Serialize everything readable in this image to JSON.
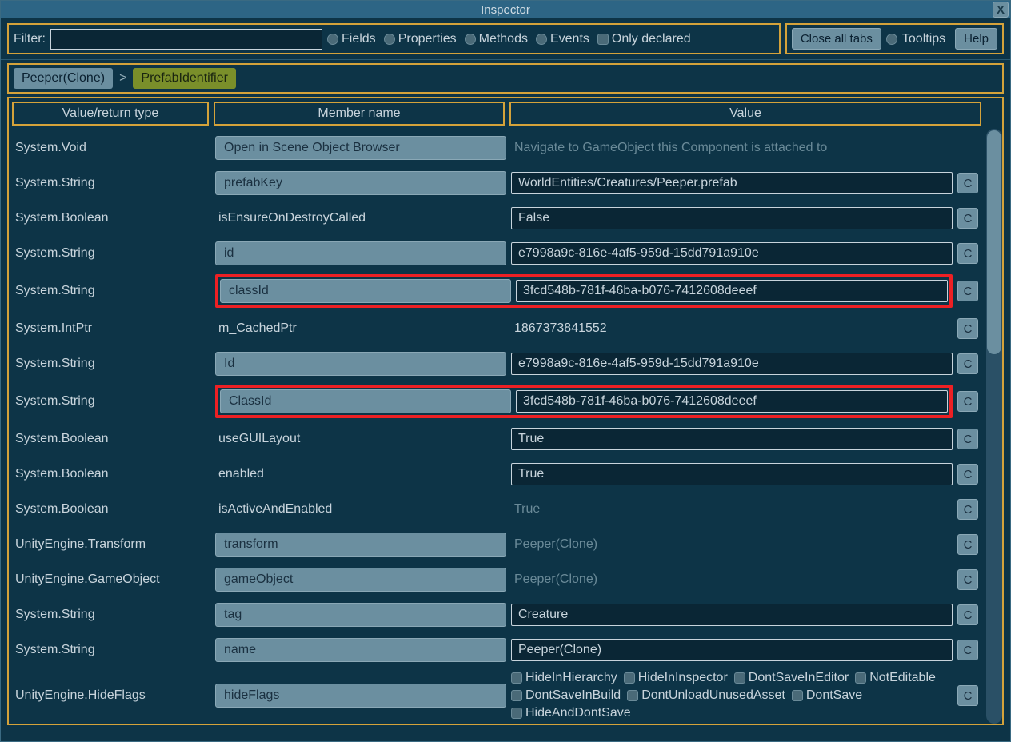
{
  "window": {
    "title": "Inspector",
    "close": "X"
  },
  "toolbar": {
    "filter_label": "Filter:",
    "filter_value": "",
    "checks": {
      "fields": "Fields",
      "properties": "Properties",
      "methods": "Methods",
      "events": "Events",
      "only_declared": "Only declared"
    },
    "close_tabs": "Close all tabs",
    "tooltips": "Tooltips",
    "help": "Help"
  },
  "breadcrumb": {
    "root": "Peeper(Clone)",
    "sep": ">",
    "current": "PrefabIdentifier"
  },
  "headers": {
    "type": "Value/return type",
    "member": "Member name",
    "value": "Value"
  },
  "copy_label": "C",
  "rows": [
    {
      "type": "System.Void",
      "member_kind": "button",
      "member": "Open in Scene Object Browser",
      "value_kind": "muted",
      "value": "Navigate to GameObject this Component is attached to",
      "c": false
    },
    {
      "type": "System.String",
      "member_kind": "button",
      "member": "prefabKey",
      "value_kind": "input",
      "value": "WorldEntities/Creatures/Peeper.prefab",
      "c": true
    },
    {
      "type": "System.Boolean",
      "member_kind": "text",
      "member": "isEnsureOnDestroyCalled",
      "value_kind": "input",
      "value": "False",
      "c": true
    },
    {
      "type": "System.String",
      "member_kind": "button",
      "member": "id",
      "value_kind": "input",
      "value": "e7998a9c-816e-4af5-959d-15dd791a910e",
      "c": true
    },
    {
      "type": "System.String",
      "member_kind": "button",
      "member": "classId",
      "value_kind": "input",
      "value": "3fcd548b-781f-46ba-b076-7412608deeef",
      "c": true,
      "highlight": true
    },
    {
      "type": "System.IntPtr",
      "member_kind": "text",
      "member": "m_CachedPtr",
      "value_kind": "text",
      "value": "1867373841552",
      "c": true
    },
    {
      "type": "System.String",
      "member_kind": "button",
      "member": "Id",
      "value_kind": "input",
      "value": "e7998a9c-816e-4af5-959d-15dd791a910e",
      "c": true
    },
    {
      "type": "System.String",
      "member_kind": "button",
      "member": "ClassId",
      "value_kind": "input",
      "value": "3fcd548b-781f-46ba-b076-7412608deeef",
      "c": true,
      "highlight": true
    },
    {
      "type": "System.Boolean",
      "member_kind": "text",
      "member": "useGUILayout",
      "value_kind": "input",
      "value": "True",
      "c": true
    },
    {
      "type": "System.Boolean",
      "member_kind": "text",
      "member": "enabled",
      "value_kind": "input",
      "value": "True",
      "c": true
    },
    {
      "type": "System.Boolean",
      "member_kind": "text",
      "member": "isActiveAndEnabled",
      "value_kind": "muted",
      "value": "True",
      "c": true
    },
    {
      "type": "UnityEngine.Transform",
      "member_kind": "button",
      "member": "transform",
      "value_kind": "muted",
      "value": "Peeper(Clone)",
      "c": true
    },
    {
      "type": "UnityEngine.GameObject",
      "member_kind": "button",
      "member": "gameObject",
      "value_kind": "muted",
      "value": "Peeper(Clone)",
      "c": true
    },
    {
      "type": "System.String",
      "member_kind": "button",
      "member": "tag",
      "value_kind": "input",
      "value": "Creature",
      "c": true
    },
    {
      "type": "System.String",
      "member_kind": "button",
      "member": "name",
      "value_kind": "input",
      "value": "Peeper(Clone)",
      "c": true
    },
    {
      "type": "UnityEngine.HideFlags",
      "member_kind": "button",
      "member": "hideFlags",
      "value_kind": "flags",
      "c": true
    }
  ],
  "hideFlags": [
    "HideInHierarchy",
    "HideInInspector",
    "DontSaveInEditor",
    "NotEditable",
    "DontSaveInBuild",
    "DontUnloadUnusedAsset",
    "DontSave",
    "HideAndDontSave"
  ]
}
